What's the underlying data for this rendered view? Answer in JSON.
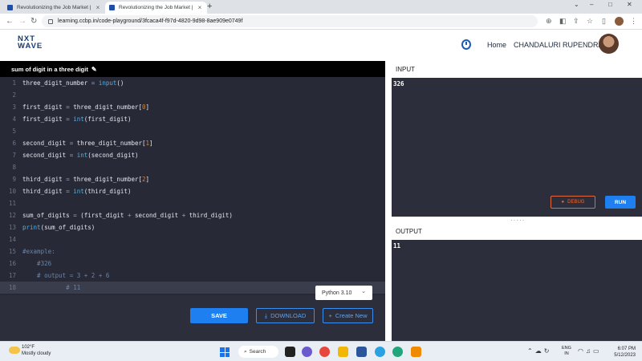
{
  "browser": {
    "tabs": [
      {
        "label": "Revolutionizing the Job Market |",
        "active": false
      },
      {
        "label": "Revolutionizing the Job Market |",
        "active": true
      }
    ],
    "url": "learning.ccbp.in/code-playground/3fcaca4f-f97d-4820-9d98-8ae909e0749f"
  },
  "header": {
    "logo_line1": "NXT",
    "logo_line2": "WAVE",
    "home_label": "Home",
    "user_name": "CHANDALURI RUPENDRA"
  },
  "editor": {
    "title": "sum of digit in a three digit",
    "lines": [
      {
        "n": "1",
        "text": "three_digit_number = input()"
      },
      {
        "n": "2",
        "text": ""
      },
      {
        "n": "3",
        "text": "first_digit = three_digit_number[0]"
      },
      {
        "n": "4",
        "text": "first_digit = int(first_digit)"
      },
      {
        "n": "5",
        "text": ""
      },
      {
        "n": "6",
        "text": "second_digit = three_digit_number[1]"
      },
      {
        "n": "7",
        "text": "second_digit = int(second_digit)"
      },
      {
        "n": "8",
        "text": ""
      },
      {
        "n": "9",
        "text": "third_digit = three_digit_number[2]"
      },
      {
        "n": "10",
        "text": "third_digit = int(third_digit)"
      },
      {
        "n": "11",
        "text": ""
      },
      {
        "n": "12",
        "text": "sum_of_digits = (first_digit + second_digit + third_digit)"
      },
      {
        "n": "13",
        "text": "print(sum_of_digits)"
      },
      {
        "n": "14",
        "text": ""
      },
      {
        "n": "15",
        "text": "#example:"
      },
      {
        "n": "16",
        "text": "    #326"
      },
      {
        "n": "17",
        "text": "    # output = 3 + 2 + 6"
      },
      {
        "n": "18",
        "text": "            # 11"
      }
    ],
    "language": "Python 3.10",
    "save_label": "SAVE",
    "download_label": "DOWNLOAD",
    "create_label": "Create New"
  },
  "input_panel": {
    "label": "INPUT",
    "value": "326",
    "debug_label": "DEBUG",
    "run_label": "RUN"
  },
  "output_panel": {
    "label": "OUTPUT",
    "value": "11"
  },
  "taskbar": {
    "weather_temp": "102°F",
    "weather_desc": "Mostly cloudy",
    "search_label": "Search",
    "lang_line1": "ENG",
    "lang_line2": "IN",
    "time": "6:07 PM",
    "date": "5/12/2023"
  }
}
